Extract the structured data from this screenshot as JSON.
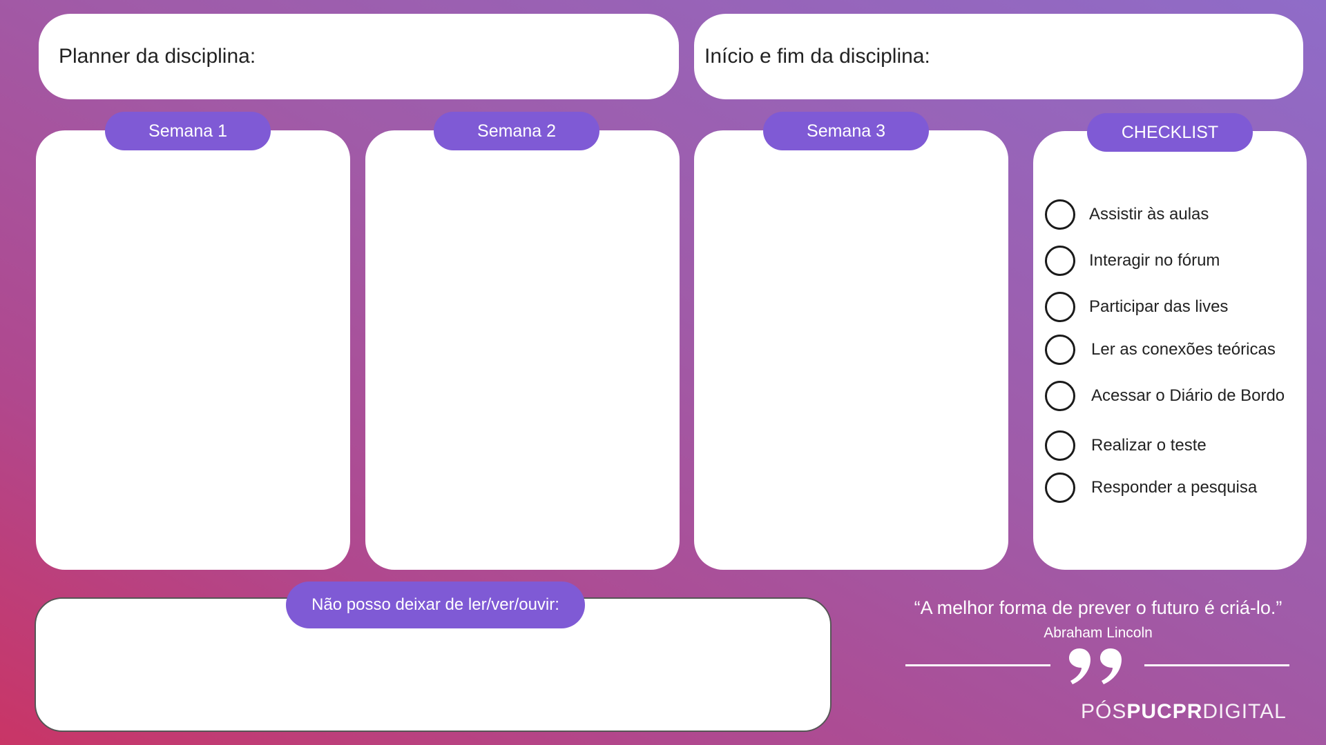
{
  "header": {
    "planner_label": "Planner da disciplina:",
    "dates_label": "Início e fim da disciplina:"
  },
  "weeks": [
    {
      "label": "Semana 1"
    },
    {
      "label": "Semana 2"
    },
    {
      "label": "Semana 3"
    }
  ],
  "checklist": {
    "title": "CHECKLIST",
    "items": [
      {
        "label": "Assistir às aulas",
        "checked": false
      },
      {
        "label": "Interagir no fórum",
        "checked": false
      },
      {
        "label": "Participar das lives",
        "checked": false
      },
      {
        "label": "Ler as conexões teóricas",
        "checked": false
      },
      {
        "label": "Acessar o Diário de Bordo",
        "checked": false
      },
      {
        "label": "Realizar o teste",
        "checked": false
      },
      {
        "label": "Responder a pesquisa",
        "checked": false
      }
    ]
  },
  "must_read": {
    "label": "Não posso deixar de ler/ver/ouvir:"
  },
  "quote": {
    "text": "“A melhor forma de prever o futuro é criá-lo.”",
    "author": "Abraham Lincoln",
    "icon": "quote-marks-icon"
  },
  "brand": {
    "part1": "PÓS",
    "part2": "PUCPR",
    "part3": "DIGITAL"
  },
  "colors": {
    "accent": "#7f5ad5",
    "gradient_start": "#c93566",
    "gradient_end": "#8f6cc8",
    "card": "#ffffff"
  }
}
